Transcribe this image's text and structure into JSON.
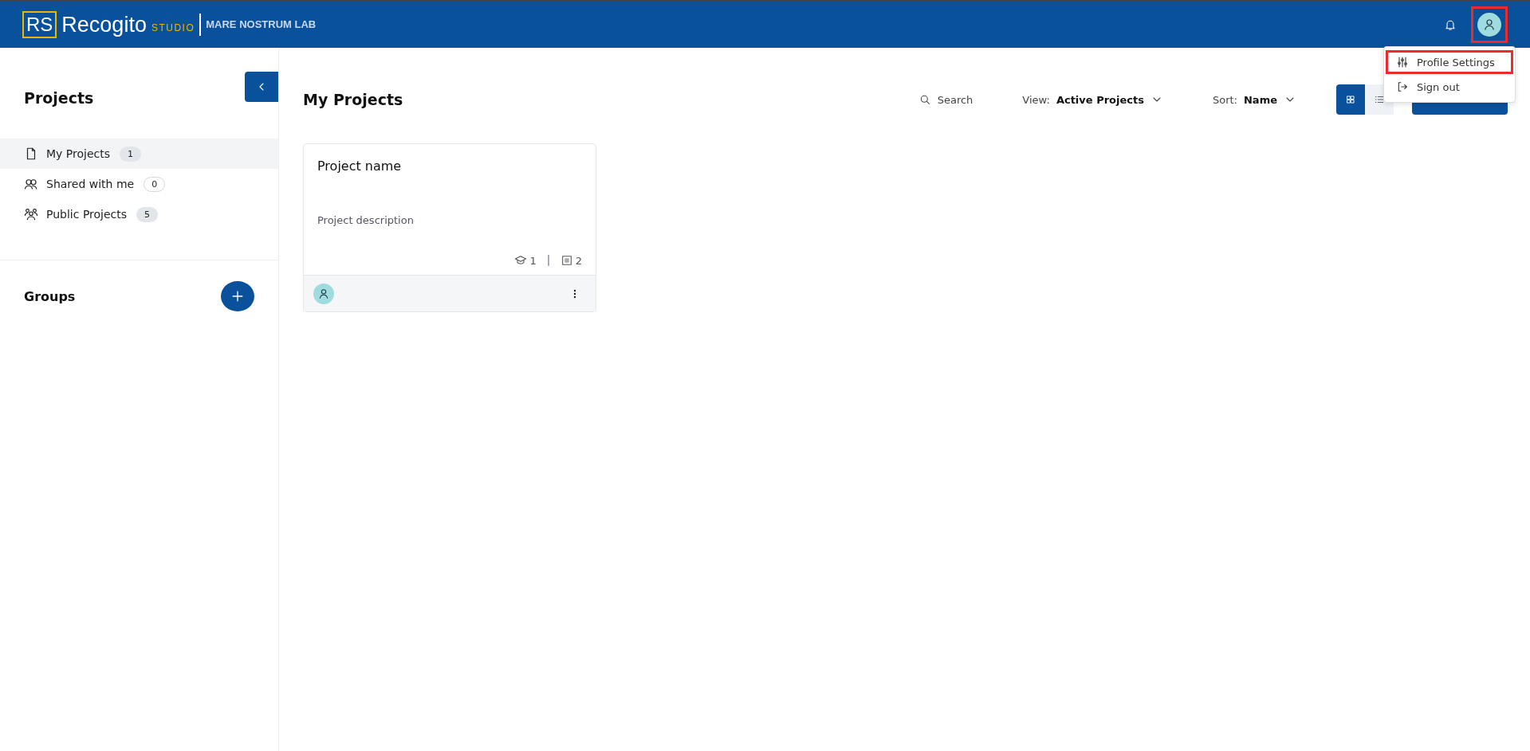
{
  "header": {
    "logo_mark": "RS",
    "brand": "Recogito",
    "brand_sub": "STUDIO",
    "org": "MARE NOSTRUM LAB",
    "avatar_highlighted": true
  },
  "user_menu": {
    "items": [
      {
        "kind": "settings",
        "label": "Profile Settings",
        "highlighted": true
      },
      {
        "kind": "signout",
        "label": "Sign out",
        "highlighted": false
      }
    ]
  },
  "sidebar": {
    "title": "Projects",
    "items": [
      {
        "kind": "doc",
        "label": "My Projects",
        "count": "1",
        "selected": true,
        "count_outlined": false
      },
      {
        "kind": "shared",
        "label": "Shared with me",
        "count": "0",
        "selected": false,
        "count_outlined": true
      },
      {
        "kind": "public",
        "label": "Public Projects",
        "count": "5",
        "selected": false,
        "count_outlined": false
      }
    ],
    "groups_title": "Groups"
  },
  "main": {
    "title": "My Projects",
    "search": "Search",
    "view_label": "View:",
    "view_value": "Active Projects",
    "sort_label": "Sort:",
    "sort_value": "Name",
    "view_modes": [
      {
        "kind": "grid",
        "selected": true
      },
      {
        "kind": "list",
        "selected": false
      }
    ],
    "cards": [
      {
        "name": "Project name",
        "description": "Project description",
        "assignments": "1",
        "documents": "2"
      }
    ]
  }
}
